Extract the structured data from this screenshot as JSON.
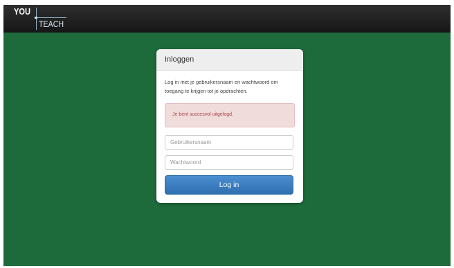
{
  "brand": {
    "logo_top": "YOU",
    "logo_bottom": "TEACH"
  },
  "login": {
    "title": "Inloggen",
    "intro": "Log in met je gebruikersnaam en wachtwoord om toegang te krijgen tot je opdrachten.",
    "alert": "Je bent succesvol uitgelogd.",
    "username_placeholder": "Gebruikersnaam",
    "password_placeholder": "Wachtwoord",
    "submit_label": "Log in"
  },
  "colors": {
    "background": "#1d6a3a",
    "topbar": "#1f1f1f",
    "primary_button": "#3a7cc0",
    "alert_bg": "#f1dcdc",
    "alert_text": "#a94442"
  }
}
